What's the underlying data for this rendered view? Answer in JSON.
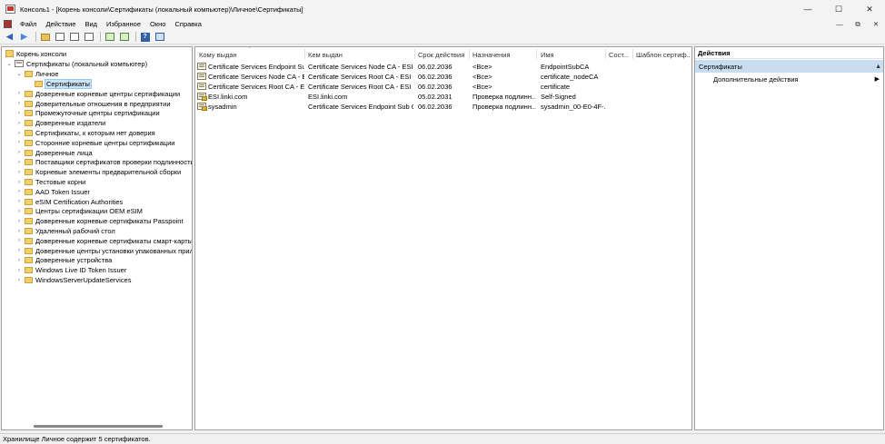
{
  "window": {
    "title": "Консоль1 - [Корень консоли\\Сертификаты (локальный компьютер)\\Личное\\Сертификаты]",
    "minimize": "—",
    "maximize": "☐",
    "close": "✕"
  },
  "menu": {
    "items": [
      "Файл",
      "Действие",
      "Вид",
      "Избранное",
      "Окно",
      "Справка"
    ],
    "right_controls": [
      "—",
      "⧉",
      "✕"
    ]
  },
  "toolbar": {
    "icons": [
      "back-arrow-icon",
      "forward-arrow-icon",
      "up-folder-icon",
      "show-tree-icon",
      "copy-icon",
      "properties-icon",
      "export-icon",
      "refresh-icon",
      "help-icon",
      "action-pane-icon"
    ]
  },
  "tree": {
    "root": "Корень консоли",
    "computer": "Сертификаты (локальный компьютер)",
    "personal": "Личное",
    "selected": "Сертификаты",
    "stores": [
      "Доверенные корневые центры сертификации",
      "Доверительные отношения в предприятии",
      "Промежуточные центры сертификации",
      "Доверенные издатели",
      "Сертификаты, к которым нет доверия",
      "Сторонние корневые центры сертификации",
      "Доверенные лица",
      "Поставщики сертификатов проверки подлинности к",
      "Корневые элементы предварительной сборки",
      "Тестовые корни",
      "AAD Token Issuer",
      "eSIM Certification Authorities",
      "Центры сертификации OEM eSIM",
      "Доверенные корневые сертификаты Passpoint",
      "Удаленный рабочий стол",
      "Доверенные корневые сертификаты смарт-карты",
      "Доверенные центры установки упакованных прилож",
      "Доверенные устройства",
      "Windows Live ID Token Issuer",
      "WindowsServerUpdateServices"
    ]
  },
  "list": {
    "columns": [
      "Кому выдан",
      "Кем выдан",
      "Срок действия",
      "Назначения",
      "Имя",
      "Сост...",
      "Шаблон сертиф..."
    ],
    "rows": [
      {
        "issued_to": "Certificate Services Endpoint Su...",
        "issued_by": "Certificate Services Node CA - ESI",
        "expires": "06.02.2036",
        "purposes": "<Все>",
        "name": "EndpointSubCA",
        "status": "",
        "template": ""
      },
      {
        "issued_to": "Certificate Services Node CA - ESI",
        "issued_by": "Certificate Services Root CA - ESI",
        "expires": "06.02.2036",
        "purposes": "<Все>",
        "name": "certificate_nodeCA",
        "status": "",
        "template": ""
      },
      {
        "issued_to": "Certificate Services Root CA - ESI",
        "issued_by": "Certificate Services Root CA - ESI",
        "expires": "06.02.2036",
        "purposes": "<Все>",
        "name": "certificate",
        "status": "",
        "template": ""
      },
      {
        "issued_to": "ESI.linki.com",
        "issued_by": "ESI.linki.com",
        "expires": "05.02.2031",
        "purposes": "Проверка подлинн...",
        "name": "Self-Signed",
        "status": "",
        "template": ""
      },
      {
        "issued_to": "sysadmin",
        "issued_by": "Certificate Services Endpoint Sub C...",
        "expires": "06.02.2036",
        "purposes": "Проверка подлинн...",
        "name": "sysadmin_00-E0-4F-...",
        "status": "",
        "template": ""
      }
    ]
  },
  "actions": {
    "title": "Действия",
    "section": "Сертификаты",
    "section_caret": "▲",
    "item": "Дополнительные действия",
    "item_arrow": "▶"
  },
  "status": {
    "text": "Хранилище Личное содержит 5 сертификатов."
  }
}
